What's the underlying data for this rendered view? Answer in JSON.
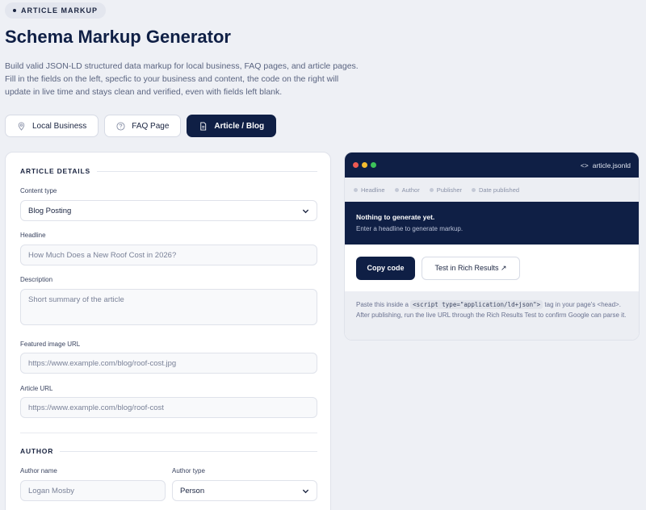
{
  "header": {
    "badge": "ARTICLE MARKUP",
    "title": "Schema Markup Generator",
    "intro": "Build valid JSON-LD structured data markup for local business, FAQ pages, and article pages. Fill in the fields on the left, specfic to your business and content, the code on the right will update in live time and stays clean and verified, even with fields left blank."
  },
  "tabs": [
    {
      "label": "Local Business",
      "icon": "map-pin-icon",
      "active": false
    },
    {
      "label": "FAQ Page",
      "icon": "help-circle-icon",
      "active": false
    },
    {
      "label": "Article / Blog",
      "icon": "document-icon",
      "active": true
    }
  ],
  "form": {
    "article_section_title": "ARTICLE DETAILS",
    "content_type_label": "Content type",
    "content_type_value": "Blog Posting",
    "headline_label": "Headline",
    "headline_placeholder": "How Much Does a New Roof Cost in 2026?",
    "description_label": "Description",
    "description_placeholder": "Short summary of the article",
    "image_label": "Featured image URL",
    "image_placeholder": "https://www.example.com/blog/roof-cost.jpg",
    "article_url_label": "Article URL",
    "article_url_placeholder": "https://www.example.com/blog/roof-cost",
    "author_section_title": "AUTHOR",
    "author_name_label": "Author name",
    "author_name_placeholder": "Logan Mosby",
    "author_type_label": "Author type",
    "author_type_value": "Person"
  },
  "preview": {
    "filename": "article.jsonld",
    "chips": [
      "Headline",
      "Author",
      "Publisher",
      "Date published"
    ],
    "empty_title": "Nothing to generate yet.",
    "empty_sub": "Enter a headline to generate markup.",
    "copy_label": "Copy code",
    "test_label": "Test in Rich Results ↗",
    "note_before": "Paste this inside a ",
    "note_code": "<script type=\"application/ld+json\">",
    "note_after": " tag in your page's <head>. After publishing, run the live URL through the Rich Results Test to confirm Google can parse it."
  },
  "colors": {
    "navy": "#0f1f45",
    "dot_red": "#ef5a52",
    "dot_yellow": "#f4bc2f",
    "dot_green": "#3dc35a"
  }
}
